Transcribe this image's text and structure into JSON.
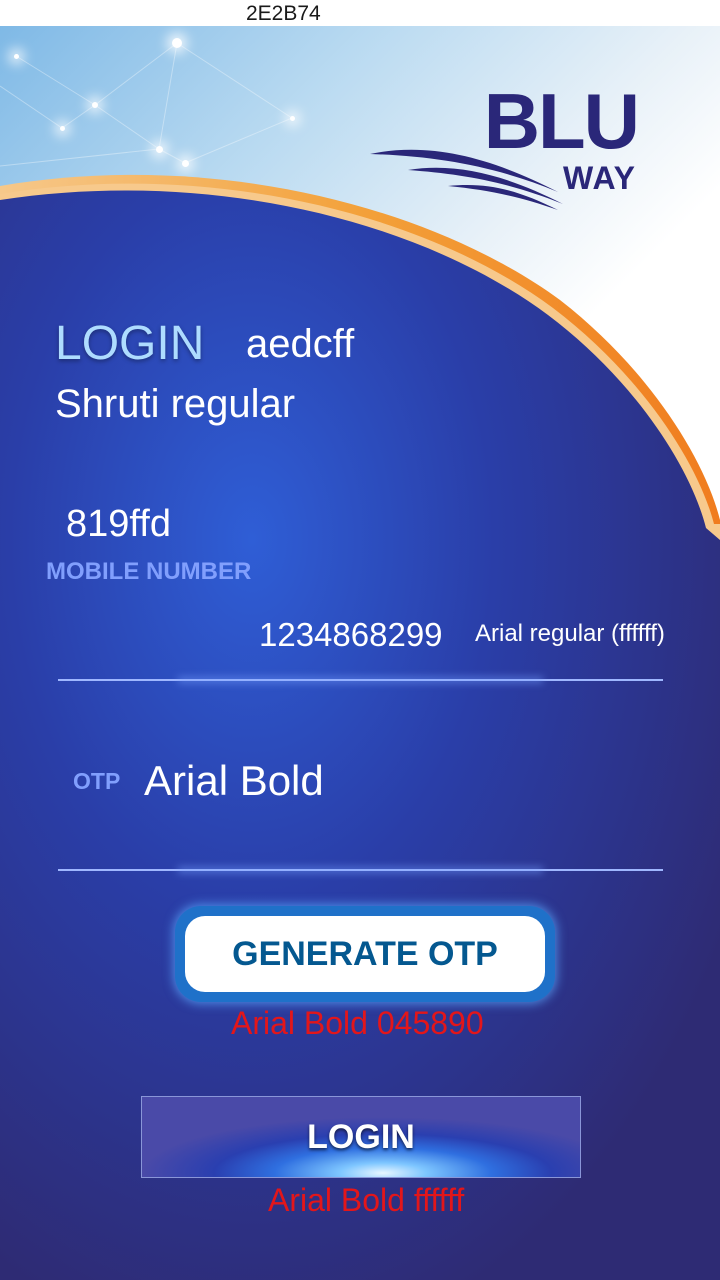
{
  "status_bar": {
    "text": "2E2B74"
  },
  "logo": {
    "blu": "BLU",
    "way": "WAY"
  },
  "login_heading": {
    "title": "LOGIN",
    "color_note": "aedcff",
    "font_note": "Shruti regular"
  },
  "mobile": {
    "color_note": "819ffd",
    "label": "MOBILE NUMBER",
    "value": "1234868299",
    "font_note": "Arial regular (ffffff)"
  },
  "otp": {
    "label": "OTP",
    "placeholder": "Arial Bold"
  },
  "generate_button": {
    "label": "GENERATE OTP",
    "note": "Arial Bold 045890"
  },
  "login_button": {
    "label": "LOGIN",
    "note": "Arial Bold ffffff"
  },
  "colors": {
    "background": "#2E2B74",
    "heading": "#aedcff",
    "label": "#819ffd",
    "generate_text": "#045890",
    "note_red": "#e3161a"
  },
  "icons": [
    "blu-way-logo-wave-icon"
  ]
}
